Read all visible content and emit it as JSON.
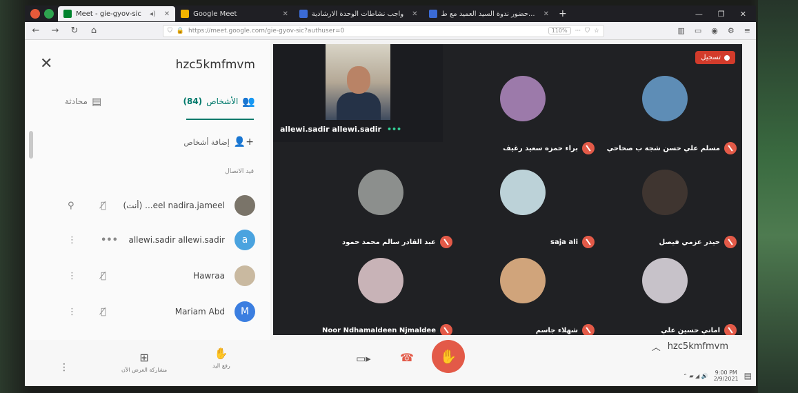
{
  "browser": {
    "tabs": [
      {
        "label": "Meet - gie-gyov-sic",
        "active": true
      },
      {
        "label": "Google Meet",
        "active": false
      },
      {
        "label": "واجب نشاطات الوحدة الارشادية",
        "active": false
      },
      {
        "label": "حضور ندوة السيد العميد مع ط...",
        "active": false
      }
    ],
    "url": "https://meet.google.com/gie-gyov-sic?authuser=0",
    "zoom": "110%"
  },
  "panel": {
    "meeting_code": "hzc5kmfmvm",
    "tab_people": "الأشخاص",
    "tab_people_count": "(84)",
    "tab_chat": "محادثة",
    "add_people": "إضافة أشخاص",
    "section_label": "قيد الاتصال",
    "participants": [
      {
        "name": "...eel nadira.jameel",
        "you": "(أنت)",
        "avatar_letter": "",
        "avatar_color": "#7a7469"
      },
      {
        "name": "allewi.sadir allewi.sadir",
        "you": "",
        "avatar_letter": "a",
        "avatar_color": "#4aa3df"
      },
      {
        "name": "Hawraa",
        "you": "",
        "avatar_letter": "",
        "avatar_color": "#c9b9a0"
      },
      {
        "name": "Mariam Abd",
        "you": "",
        "avatar_letter": "M",
        "avatar_color": "#3b7ee0"
      }
    ]
  },
  "grid": {
    "record_label": "تسجيل",
    "speaker": "allewi.sadir allewi.sadir",
    "tiles": [
      {
        "name": "براء حمزه سعيد رغيف",
        "avatar_color": "#9c7aaa"
      },
      {
        "name": "مسلم علي حسن شجة ب صحاحي",
        "avatar_color": "#5e8db6"
      },
      {
        "name": "عبد القادر سالم محمد حمود",
        "avatar_color": "#8c8f8d"
      },
      {
        "name": "saja ali",
        "avatar_color": "#bcd2d8"
      },
      {
        "name": "حيدر عزمي فيصل",
        "avatar_color": "#3f3530"
      },
      {
        "name": "Noor Ndhamaldeen Njmaldee",
        "avatar_color": "#c8b3b7"
      },
      {
        "name": "شهلاء جاسم",
        "avatar_color": "#d0a47b"
      },
      {
        "name": "اماني حسين علي",
        "avatar_color": "#c7c2c9"
      }
    ]
  },
  "bottombar": {
    "present_label": "مشاركة العرض الآن",
    "raise_hand_label": "رفع اليد",
    "meeting_code": "hzc5kmfmvm",
    "taskbar_time": "9:00 PM",
    "taskbar_date": "2/9/2021"
  },
  "colors": {
    "accent": "#00796b",
    "hangup": "#e35a48",
    "record": "#d23b2b"
  }
}
